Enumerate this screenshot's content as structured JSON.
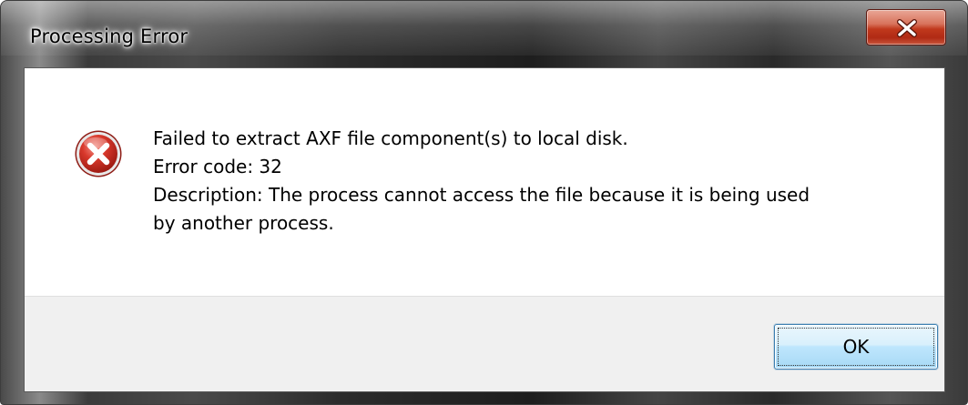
{
  "window": {
    "title": "Processing Error"
  },
  "icons": {
    "close": "close-icon",
    "error": "error-icon"
  },
  "message": {
    "line1": "Failed to extract AXF file component(s) to local disk.",
    "line2": "Error code: 32",
    "line3": "Description: The process cannot access the file because it is being used",
    "line4": "by another process."
  },
  "buttons": {
    "ok_label": "OK"
  },
  "colors": {
    "error_red": "#c62a20",
    "close_button_red": "#c1391d",
    "button_area_gray": "#f0f0f0",
    "ok_button_border": "#3c7fb1"
  }
}
